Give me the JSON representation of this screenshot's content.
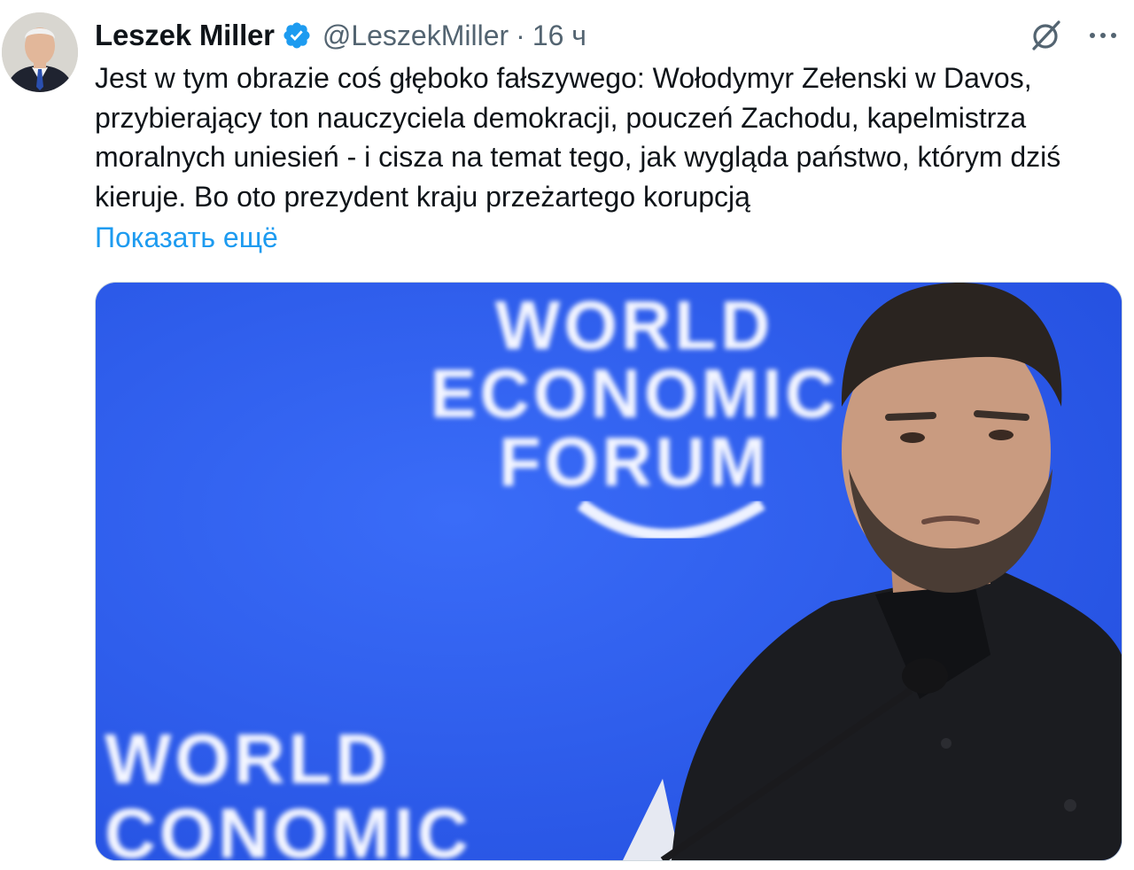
{
  "tweet": {
    "author_name": "Leszek Miller",
    "handle": "@LeszekMiller",
    "separator": "·",
    "time": "16 ч",
    "text": "Jest w tym obrazie coś głęboko fałszywego: Wołodymyr Zełenski w Davos, przybierający ton nauczyciela demokracji, pouczeń Zachodu, kapelmistrza moralnych uniesień - i cisza na temat tego, jak wygląda państwo, którym dziś kieruje. Bo oto prezydent kraju przeżartego korupcją",
    "show_more": "Показать ещё"
  },
  "media": {
    "logo_top_lines": [
      "WORLD",
      "ECONOMIC",
      "FORUM"
    ],
    "logo_bottom_lines": [
      "WORLD",
      "CONOMIC"
    ]
  },
  "icons": {
    "verified": "verified-badge-icon",
    "grok": "grok-icon",
    "more": "more-icon"
  },
  "colors": {
    "link": "#1d9bf0",
    "secondary_text": "#536471",
    "verified": "#1d9bf0",
    "media_background": "#2f5ff0"
  }
}
